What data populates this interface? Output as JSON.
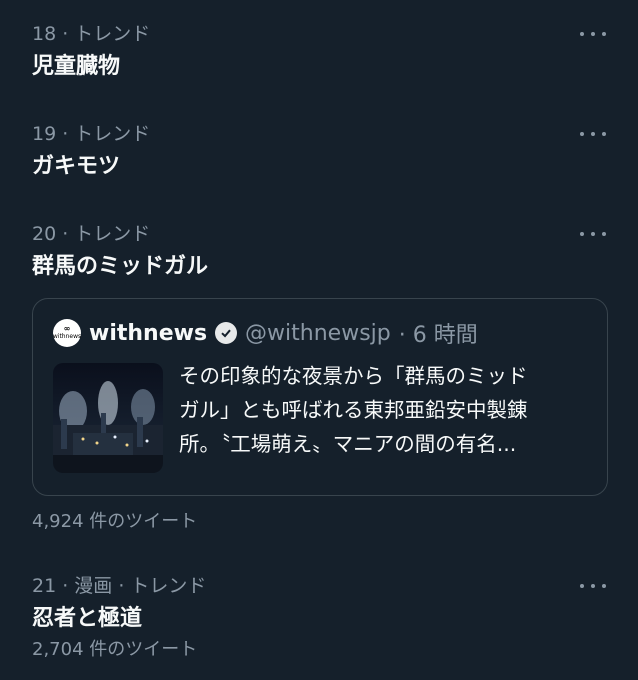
{
  "trends": [
    {
      "meta": "18 · トレンド",
      "title": "児童臓物"
    },
    {
      "meta": "19 · トレンド",
      "title": "ガキモツ"
    },
    {
      "meta": "20 · トレンド",
      "title": "群馬のミッドガル",
      "count": "4,924 件のツイート"
    },
    {
      "meta": "21 · 漫画 · トレンド",
      "title": "忍者と極道",
      "count": "2,704 件のツイート"
    }
  ],
  "card": {
    "author": "withnews",
    "logo_text": "withnews",
    "handle": "@withnewsjp",
    "time": "· 6 時間",
    "excerpt_line1": "その印象的な夜景から「群馬のミッド",
    "excerpt_line2": "ガル」とも呼ばれる東邦亜鉛安中製錬",
    "excerpt_line3": "所。〝工場萌え〟マニアの間の有名..."
  },
  "icons": {
    "more": "more-horizontal-icon",
    "verified": "verified-badge-icon"
  },
  "colors": {
    "background": "#15202b",
    "primary_text": "#f7f9f9",
    "secondary_text": "#8b98a5",
    "border": "#38444d"
  }
}
